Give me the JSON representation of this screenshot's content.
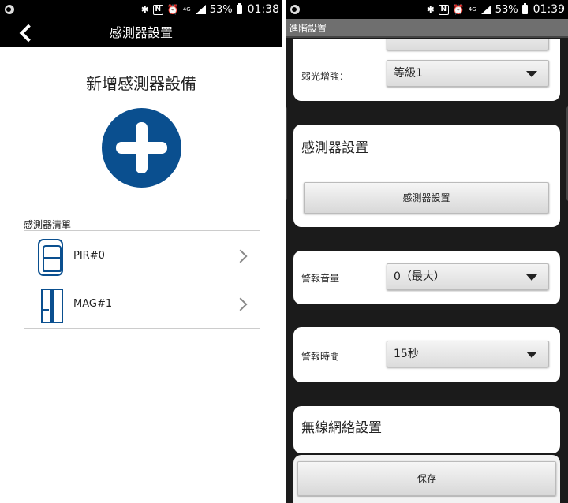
{
  "left": {
    "status": {
      "battery": "53%",
      "time": "01:38",
      "network": "4G"
    },
    "header": {
      "title": "感測器設置"
    },
    "add": {
      "title": "新增感測器設備"
    },
    "list": {
      "header": "感測器清單",
      "items": [
        {
          "label": "PIR#0",
          "icon": "pir-sensor-icon"
        },
        {
          "label": "MAG#1",
          "icon": "magnetic-sensor-icon"
        }
      ]
    }
  },
  "right": {
    "status": {
      "battery": "53%",
      "time": "01:39",
      "network": "4G"
    },
    "header": {
      "title": "進階設置"
    },
    "low_light": {
      "label": "弱光增強：",
      "value": "等級1"
    },
    "sensor_card": {
      "title": "感測器設置",
      "button": "感測器設置"
    },
    "alarm_volume": {
      "label": "警報音量",
      "value": "0（最大）"
    },
    "alarm_time": {
      "label": "警報時間",
      "value": "15秒"
    },
    "wireless_card": {
      "title": "無線網絡設置"
    },
    "save": {
      "label": "保存"
    }
  },
  "colors": {
    "accent": "#0a4f8f",
    "dark_bg": "#1b1b1b",
    "appbar_gray": "#6f6f6f"
  }
}
